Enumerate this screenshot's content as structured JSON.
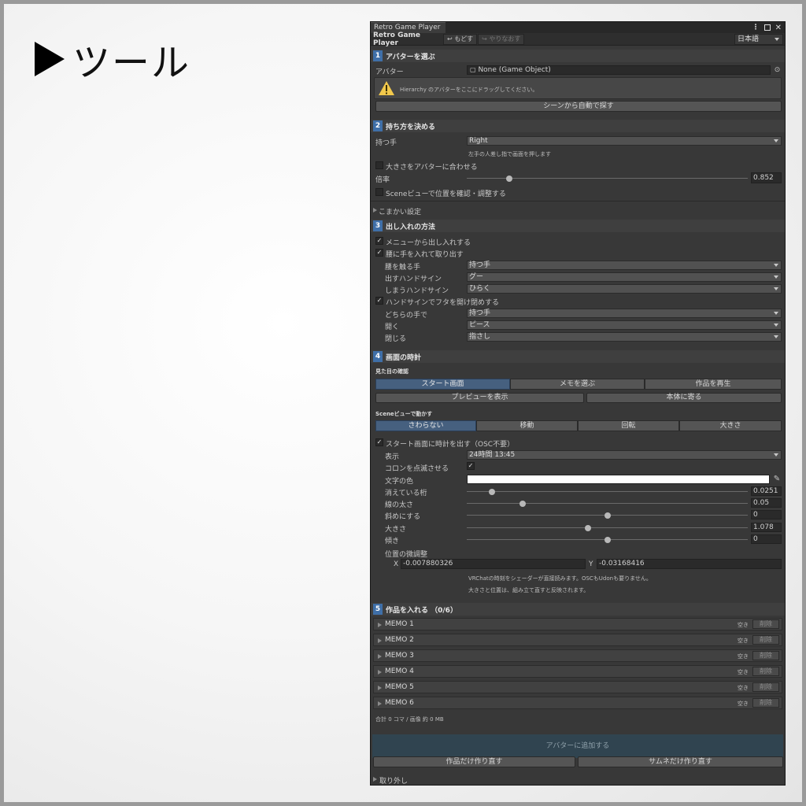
{
  "heading": {
    "text": "ツール"
  },
  "window": {
    "tab_title": "Retro Game Player",
    "toolbar": {
      "app_name": "Retro Game Player",
      "undo": "↩ もどす",
      "redo": "↪ やりなおす",
      "language": "日本語"
    }
  },
  "s1": {
    "num": "1",
    "title": "アバターを選ぶ",
    "avatar_label": "アバター",
    "avatar_value": "None (Game Object)",
    "help": "Hierarchy のアバターをここにドラッグしてください。",
    "auto_find": "シーンから自動で探す"
  },
  "s2": {
    "num": "2",
    "title": "持ち方を決める",
    "hand_label": "持つ手",
    "hand_value": "Right",
    "hand_hint": "左手の人差し指で画面を押します",
    "fit_label": "大きさをアバターに合わせる",
    "fit_checked": false,
    "scale_label": "倍率",
    "scale_value": "0.852",
    "scale_level": 0.15,
    "scene_label": "Sceneビューで位置を確認・調整する",
    "scene_checked": false,
    "detail": "こまかい設定"
  },
  "s3": {
    "num": "3",
    "title": "出し入れの方法",
    "menu_label": "メニューから出し入れする",
    "menu_checked": true,
    "waist_label": "腰に手を入れて取り出す",
    "waist_checked": true,
    "touch_hand_label": "腰を触る手",
    "touch_hand_value": "持つ手",
    "out_sign_label": "出すハンドサイン",
    "out_sign_value": "グー",
    "in_sign_label": "しまうハンドサイン",
    "in_sign_value": "ひらく",
    "lid_label": "ハンドサインでフタを開け閉めする",
    "lid_checked": true,
    "which_hand_label": "どちらの手で",
    "which_hand_value": "持つ手",
    "open_label": "開く",
    "open_value": "ピース",
    "close_label": "閉じる",
    "close_value": "指さし"
  },
  "s4": {
    "num": "4",
    "title": "画面の時計",
    "look_title": "見た目の確認",
    "look_tabs": [
      "スタート画面",
      "メモを選ぶ",
      "作品を再生"
    ],
    "preview_btn": "プレビューを表示",
    "near_btn": "本体に寄る",
    "scene_title": "Sceneビューで動かす",
    "scene_tabs": [
      "さわらない",
      "移動",
      "回転",
      "大きさ"
    ],
    "clock_label": "スタート画面に時計を出す（OSC不要）",
    "clock_checked": true,
    "display_label": "表示",
    "display_value": "24時間  13:45",
    "colon_label": "コロンを点滅させる",
    "colon_checked": true,
    "color_label": "文字の色",
    "text_color": "#ffffff",
    "sliders": [
      {
        "label": "消えている桁",
        "value": "0.0251",
        "level": 0.09
      },
      {
        "label": "線の太さ",
        "value": "0.05",
        "level": 0.2
      },
      {
        "label": "斜めにする",
        "value": "0",
        "level": 0.5
      },
      {
        "label": "大きさ",
        "value": "1.078",
        "level": 0.43
      },
      {
        "label": "傾き",
        "value": "0",
        "level": 0.5
      }
    ],
    "offset_label": "位置の微調整",
    "x_label": "X",
    "x_value": "-0.007880326",
    "y_label": "Y",
    "y_value": "-0.03168416",
    "note1": "VRChatの時刻をシェーダーが直接読みます。OSCもUdonも要りません。",
    "note2": "大きさと位置は、組み立て直すと反映されます。"
  },
  "s5": {
    "num": "5",
    "title": "作品を入れる （0/6）",
    "memos": [
      {
        "name": "MEMO 1",
        "status": "空き",
        "delete": "削除"
      },
      {
        "name": "MEMO 2",
        "status": "空き",
        "delete": "削除"
      },
      {
        "name": "MEMO 3",
        "status": "空き",
        "delete": "削除"
      },
      {
        "name": "MEMO 4",
        "status": "空き",
        "delete": "削除"
      },
      {
        "name": "MEMO 5",
        "status": "空き",
        "delete": "削除"
      },
      {
        "name": "MEMO 6",
        "status": "空き",
        "delete": "削除"
      }
    ],
    "summary": "合計 0 コマ / 画像 約 0 MB"
  },
  "footer": {
    "add_btn": "アバターに追加する",
    "rebuild_works": "作品だけ作り直す",
    "rebuild_thumbs": "サムネだけ作り直す",
    "remove": "取り外し"
  }
}
